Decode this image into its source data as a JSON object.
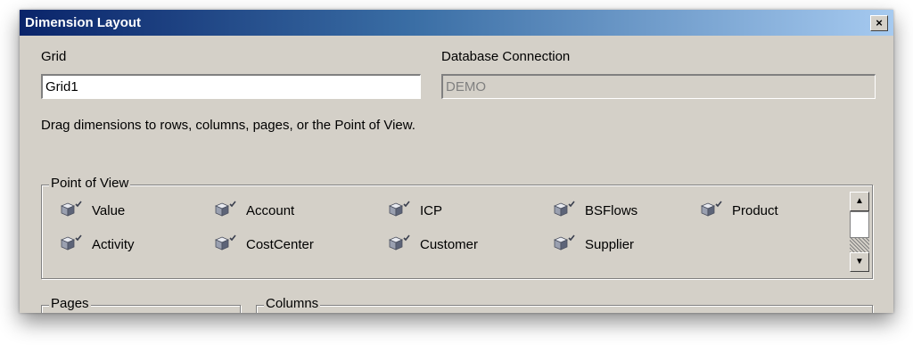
{
  "window": {
    "title": "Dimension Layout",
    "close_label": "×"
  },
  "grid": {
    "label": "Grid",
    "value": "Grid1"
  },
  "database": {
    "label": "Database Connection",
    "value": "DEMO"
  },
  "instructions": "Drag dimensions to rows, columns, pages, or the Point of View.",
  "point_of_view": {
    "title": "Point of View",
    "dimensions": [
      "Value",
      "Account",
      "ICP",
      "BSFlows",
      "Product",
      "Activity",
      "CostCenter",
      "Customer",
      "Supplier"
    ]
  },
  "pages": {
    "title": "Pages"
  },
  "columns": {
    "title": "Columns"
  },
  "scrollbar": {
    "up_glyph": "▲",
    "down_glyph": "▼"
  },
  "colors": {
    "title_gradient_start": "#0a246a",
    "title_gradient_end": "#a6caf0",
    "window_bg": "#d4d0c8",
    "icon": "cube-dimension-icon"
  }
}
